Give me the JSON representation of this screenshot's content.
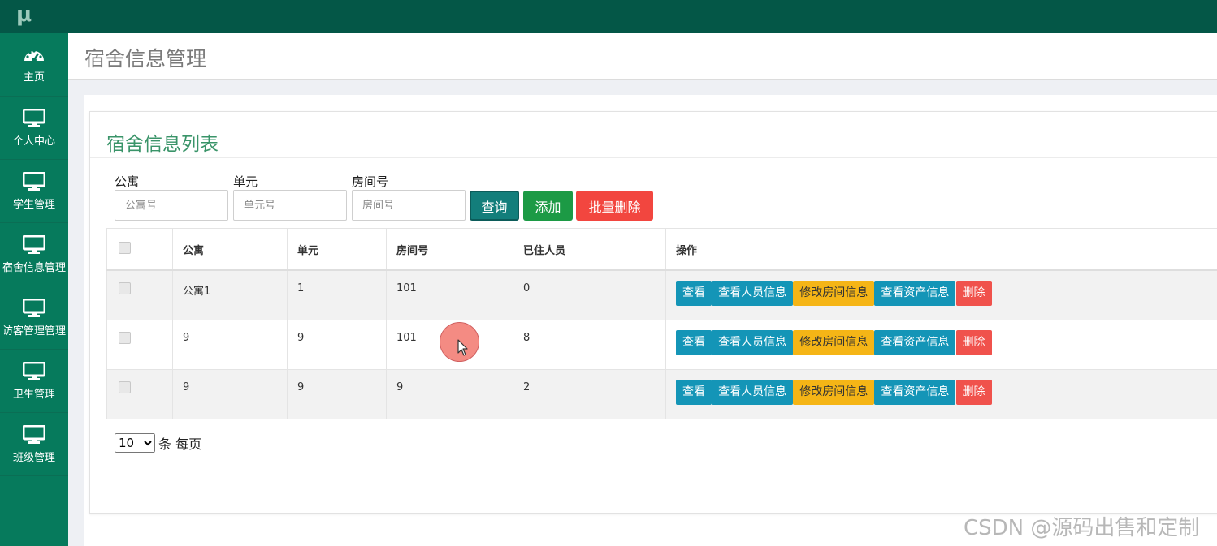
{
  "app": {
    "logo": "μ"
  },
  "sidebar": {
    "items": [
      {
        "label": "主页",
        "icon": "dashboard-icon"
      },
      {
        "label": "个人中心",
        "icon": "monitor-icon"
      },
      {
        "label": "学生管理",
        "icon": "monitor-icon"
      },
      {
        "label": "宿舍信息管理",
        "icon": "monitor-icon"
      },
      {
        "label": "访客管理管理",
        "icon": "monitor-icon"
      },
      {
        "label": "卫生管理",
        "icon": "monitor-icon"
      },
      {
        "label": "班级管理",
        "icon": "monitor-icon"
      }
    ]
  },
  "header": {
    "title": "宿舍信息管理"
  },
  "card": {
    "title": "宿舍信息列表"
  },
  "search": {
    "apartment_label": "公寓",
    "apartment_placeholder": "公寓号",
    "unit_label": "单元",
    "unit_placeholder": "单元号",
    "room_label": "房间号",
    "room_placeholder": "房间号",
    "query_label": "查询",
    "add_label": "添加",
    "bulk_delete_label": "批量删除"
  },
  "table": {
    "headers": [
      "公寓",
      "单元",
      "房间号",
      "已住人员",
      "操作"
    ],
    "rows": [
      {
        "apartment": "公寓1",
        "unit": "1",
        "room": "101",
        "occupants": "0"
      },
      {
        "apartment": "9",
        "unit": "9",
        "room": "101",
        "occupants": "8"
      },
      {
        "apartment": "9",
        "unit": "9",
        "room": "9",
        "occupants": "2"
      }
    ],
    "actions": {
      "view": "查看",
      "view_people": "查看人员信息",
      "edit_room": "修改房间信息",
      "view_assets": "查看资产信息",
      "delete": "删除"
    }
  },
  "pagination": {
    "page_size": "10",
    "suffix": "条 每页"
  },
  "watermark": "CSDN @源码出售和定制",
  "colors": {
    "topbar": "#045747",
    "sidebar": "#067a5c",
    "title_green": "#3a9469",
    "btn_query": "#137e7b",
    "btn_add": "#1c9a45",
    "btn_bulk": "#f2463f",
    "action_blue": "#1495b7",
    "action_yellow": "#f5b516",
    "action_red": "#f0524c"
  }
}
